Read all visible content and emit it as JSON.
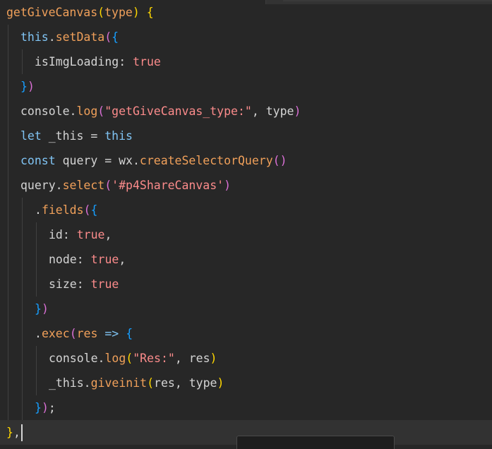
{
  "editor": {
    "colors": {
      "background": "#272727",
      "current_line": "#323232",
      "function": "#f0a05a",
      "keyword": "#80c4f4",
      "plain": "#d4d4d4",
      "string": "#fb8b8b",
      "bracket_gold": "#ffd700",
      "bracket_purple": "#da70d6",
      "bracket_blue": "#179fff",
      "guide": "#404040"
    },
    "lines": [
      {
        "indent": 0,
        "tokens": [
          {
            "t": "getGiveCanvas",
            "c": "function"
          },
          {
            "t": "(",
            "c": "bracket_gold"
          },
          {
            "t": "type",
            "c": "function"
          },
          {
            "t": ")",
            "c": "bracket_gold"
          },
          {
            "t": " ",
            "c": "plain"
          },
          {
            "t": "{",
            "c": "bracket_gold"
          }
        ]
      },
      {
        "indent": 1,
        "tokens": [
          {
            "t": "this",
            "c": "keyword"
          },
          {
            "t": ".",
            "c": "plain"
          },
          {
            "t": "setData",
            "c": "function"
          },
          {
            "t": "(",
            "c": "bracket_purple"
          },
          {
            "t": "{",
            "c": "bracket_blue"
          }
        ]
      },
      {
        "indent": 2,
        "tokens": [
          {
            "t": "isImgLoading: ",
            "c": "plain"
          },
          {
            "t": "true",
            "c": "string"
          }
        ]
      },
      {
        "indent": 1,
        "tokens": [
          {
            "t": "}",
            "c": "bracket_blue"
          },
          {
            "t": ")",
            "c": "bracket_purple"
          }
        ]
      },
      {
        "indent": 1,
        "tokens": [
          {
            "t": "console.",
            "c": "plain"
          },
          {
            "t": "log",
            "c": "function"
          },
          {
            "t": "(",
            "c": "bracket_purple"
          },
          {
            "t": "\"getGiveCanvas_type:\"",
            "c": "string"
          },
          {
            "t": ", type",
            "c": "plain"
          },
          {
            "t": ")",
            "c": "bracket_purple"
          }
        ]
      },
      {
        "indent": 1,
        "tokens": [
          {
            "t": "let",
            "c": "keyword"
          },
          {
            "t": " _this = ",
            "c": "plain"
          },
          {
            "t": "this",
            "c": "keyword"
          }
        ]
      },
      {
        "indent": 1,
        "tokens": [
          {
            "t": "const",
            "c": "keyword"
          },
          {
            "t": " query = wx.",
            "c": "plain"
          },
          {
            "t": "createSelectorQuery",
            "c": "function"
          },
          {
            "t": "()",
            "c": "bracket_purple"
          }
        ]
      },
      {
        "indent": 1,
        "tokens": [
          {
            "t": "query.",
            "c": "plain"
          },
          {
            "t": "select",
            "c": "function"
          },
          {
            "t": "(",
            "c": "bracket_purple"
          },
          {
            "t": "'#p4ShareCanvas'",
            "c": "string"
          },
          {
            "t": ")",
            "c": "bracket_purple"
          }
        ]
      },
      {
        "indent": 2,
        "tokens": [
          {
            "t": ".",
            "c": "plain"
          },
          {
            "t": "fields",
            "c": "function"
          },
          {
            "t": "(",
            "c": "bracket_purple"
          },
          {
            "t": "{",
            "c": "bracket_blue"
          }
        ]
      },
      {
        "indent": 3,
        "tokens": [
          {
            "t": "id: ",
            "c": "plain"
          },
          {
            "t": "true",
            "c": "string"
          },
          {
            "t": ",",
            "c": "plain"
          }
        ]
      },
      {
        "indent": 3,
        "tokens": [
          {
            "t": "node: ",
            "c": "plain"
          },
          {
            "t": "true",
            "c": "string"
          },
          {
            "t": ",",
            "c": "plain"
          }
        ]
      },
      {
        "indent": 3,
        "tokens": [
          {
            "t": "size: ",
            "c": "plain"
          },
          {
            "t": "true",
            "c": "string"
          }
        ]
      },
      {
        "indent": 2,
        "tokens": [
          {
            "t": "}",
            "c": "bracket_blue"
          },
          {
            "t": ")",
            "c": "bracket_purple"
          }
        ]
      },
      {
        "indent": 2,
        "tokens": [
          {
            "t": ".",
            "c": "plain"
          },
          {
            "t": "exec",
            "c": "function"
          },
          {
            "t": "(",
            "c": "bracket_purple"
          },
          {
            "t": "res",
            "c": "function"
          },
          {
            "t": " => ",
            "c": "keyword"
          },
          {
            "t": "{",
            "c": "bracket_blue"
          }
        ]
      },
      {
        "indent": 3,
        "tokens": [
          {
            "t": "console.",
            "c": "plain"
          },
          {
            "t": "log",
            "c": "function"
          },
          {
            "t": "(",
            "c": "bracket_gold"
          },
          {
            "t": "\"Res:\"",
            "c": "string"
          },
          {
            "t": ", res",
            "c": "plain"
          },
          {
            "t": ")",
            "c": "bracket_gold"
          }
        ]
      },
      {
        "indent": 3,
        "tokens": [
          {
            "t": "_this.",
            "c": "plain"
          },
          {
            "t": "giveinit",
            "c": "function"
          },
          {
            "t": "(",
            "c": "bracket_gold"
          },
          {
            "t": "res, type",
            "c": "plain"
          },
          {
            "t": ")",
            "c": "bracket_gold"
          }
        ]
      },
      {
        "indent": 2,
        "tokens": [
          {
            "t": "}",
            "c": "bracket_blue"
          },
          {
            "t": ")",
            "c": "bracket_purple"
          },
          {
            "t": ";",
            "c": "plain"
          }
        ]
      },
      {
        "indent": 0,
        "current": true,
        "tokens": [
          {
            "t": "}",
            "c": "bracket_gold"
          },
          {
            "t": ",",
            "c": "plain"
          }
        ]
      }
    ]
  }
}
